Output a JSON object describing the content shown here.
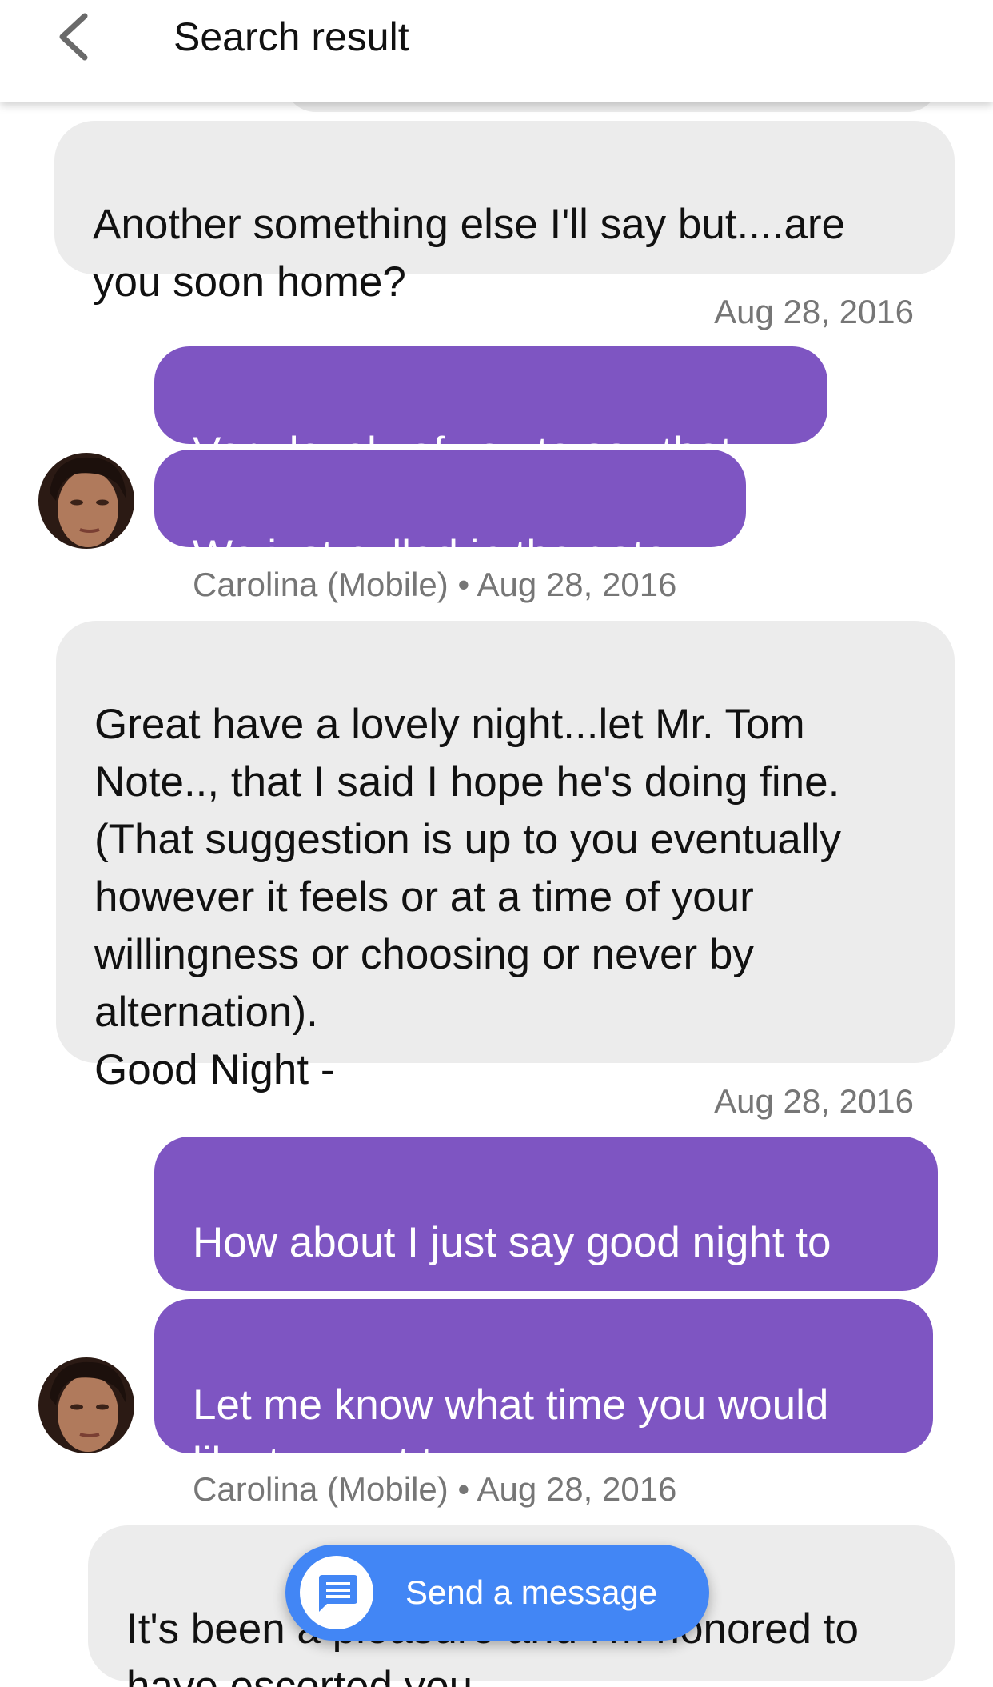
{
  "header": {
    "title": "Search result",
    "back_icon": "chevron-left-icon"
  },
  "messages": [
    {
      "direction": "incoming",
      "text": "Another something else I'll say but....are\nyou soon home?"
    },
    {
      "timestamp": "Aug 28, 2016"
    },
    {
      "direction": "outgoing",
      "text": "Very lovely of you to say that."
    },
    {
      "direction": "outgoing",
      "text": "We just pulled in the gate"
    },
    {
      "sender_name": "Carolina (Mobile)",
      "separator": "•",
      "timestamp": "Aug 28, 2016"
    },
    {
      "direction": "incoming",
      "text": "Great have a lovely night...let Mr. Tom\nNote.., that I said I hope he's doing fine.\n(That suggestion is up to you eventually\nhowever it feels or at a time of your\nwillingness or choosing or never by\nalternation).\nGood Night -"
    },
    {
      "timestamp": "Aug 28, 2016"
    },
    {
      "direction": "outgoing",
      "text": "How about I just say good night to\nyou."
    },
    {
      "direction": "outgoing",
      "text": "Let me know what time you would\nlike to meet tomorrow."
    },
    {
      "sender_name": "Carolina (Mobile)",
      "separator": "•",
      "timestamp": "Aug 28, 2016"
    },
    {
      "direction": "incoming",
      "text": "It's been a pleasure and I'm honored to\nhave escorted you"
    }
  ],
  "fab": {
    "label": "Send a message",
    "icon": "message-icon"
  },
  "colors": {
    "outgoing_bubble": "#7e55c2",
    "incoming_bubble": "#ececec",
    "fab": "#4286f5",
    "meta_text": "#767676"
  }
}
